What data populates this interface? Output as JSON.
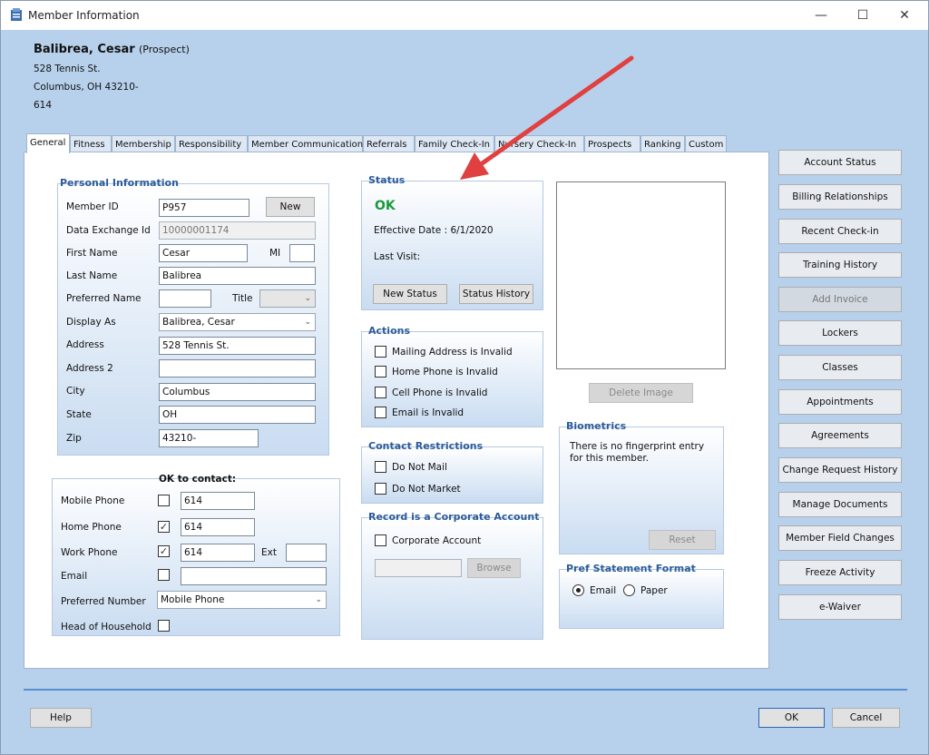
{
  "window": {
    "title": "Member Information",
    "minimize": "—",
    "maximize": "☐",
    "close": "✕"
  },
  "member": {
    "name": "Balibrea, Cesar",
    "status": "(Prospect)",
    "address1": "528 Tennis St.",
    "address2": "Columbus, OH  43210-",
    "address3": "614"
  },
  "tabs": [
    "General",
    "Fitness",
    "Membership",
    "Responsibility",
    "Member Communication",
    "Referrals",
    "Family Check-In",
    "Nursery Check-In",
    "Prospects",
    "Ranking",
    "Custom"
  ],
  "personal": {
    "title": "Personal Information",
    "member_id_label": "Member ID",
    "member_id": "P957",
    "new_button": "New",
    "data_exchange_label": "Data Exchange Id",
    "data_exchange": "10000001174",
    "first_name_label": "First Name",
    "first_name": "Cesar",
    "mi_label": "MI",
    "mi": "",
    "last_name_label": "Last Name",
    "last_name": "Balibrea",
    "preferred_name_label": "Preferred Name",
    "preferred_name": "",
    "title_label": "Title",
    "title_value": "",
    "display_as_label": "Display As",
    "display_as": "Balibrea, Cesar",
    "address_label": "Address",
    "address": "528 Tennis St.",
    "address2_label": "Address 2",
    "address2": "",
    "city_label": "City",
    "city": "Columbus",
    "state_label": "State",
    "state": "OH",
    "zip_label": "Zip",
    "zip": "43210-"
  },
  "contact": {
    "ok_label": "OK to contact:",
    "mobile_label": "Mobile Phone",
    "mobile_checked": false,
    "mobile": "614",
    "home_label": "Home Phone",
    "home_checked": true,
    "home": "614",
    "work_label": "Work Phone",
    "work_checked": true,
    "work": "614",
    "ext_label": "Ext",
    "ext": "",
    "email_label": "Email",
    "email_checked": false,
    "email": "",
    "preferred_label": "Preferred Number",
    "preferred": "Mobile Phone",
    "head_label": "Head of Household",
    "head_checked": false
  },
  "status": {
    "title": "Status",
    "value": "OK",
    "effective": "Effective Date : 6/1/2020",
    "last_visit": "Last Visit:",
    "new_status_button": "New Status",
    "history_button": "Status History"
  },
  "actions": {
    "title": "Actions",
    "items": [
      "Mailing Address is Invalid",
      "Home Phone is Invalid",
      "Cell Phone is Invalid",
      "Email is Invalid"
    ]
  },
  "restrictions": {
    "title": "Contact Restrictions",
    "items": [
      "Do Not Mail",
      "Do Not Market"
    ]
  },
  "corporate": {
    "title": "Record is a Corporate Account",
    "checkbox": "Corporate Account",
    "browse": "Browse",
    "path": ""
  },
  "image": {
    "delete_button": "Delete Image"
  },
  "biometrics": {
    "title": "Biometrics",
    "message": "There is no fingerprint entry for this member.",
    "reset": "Reset"
  },
  "statement": {
    "title": "Pref Statement Format",
    "email": "Email",
    "paper": "Paper",
    "selected": "Email"
  },
  "sidebar": [
    "Account Status",
    "Billing Relationships",
    "Recent Check-in",
    "Training History",
    "Add Invoice",
    "Lockers",
    "Classes",
    "Appointments",
    "Agreements",
    "Change Request History",
    "Manage Documents",
    "Member Field Changes",
    "Freeze Activity",
    "e-Waiver"
  ],
  "footer": {
    "help": "Help",
    "ok": "OK",
    "cancel": "Cancel"
  },
  "colors": {
    "background": "#b7d1ec",
    "group_title": "#2b5b9a",
    "ok_green": "#1a9a3a",
    "arrow": "#e04040"
  }
}
